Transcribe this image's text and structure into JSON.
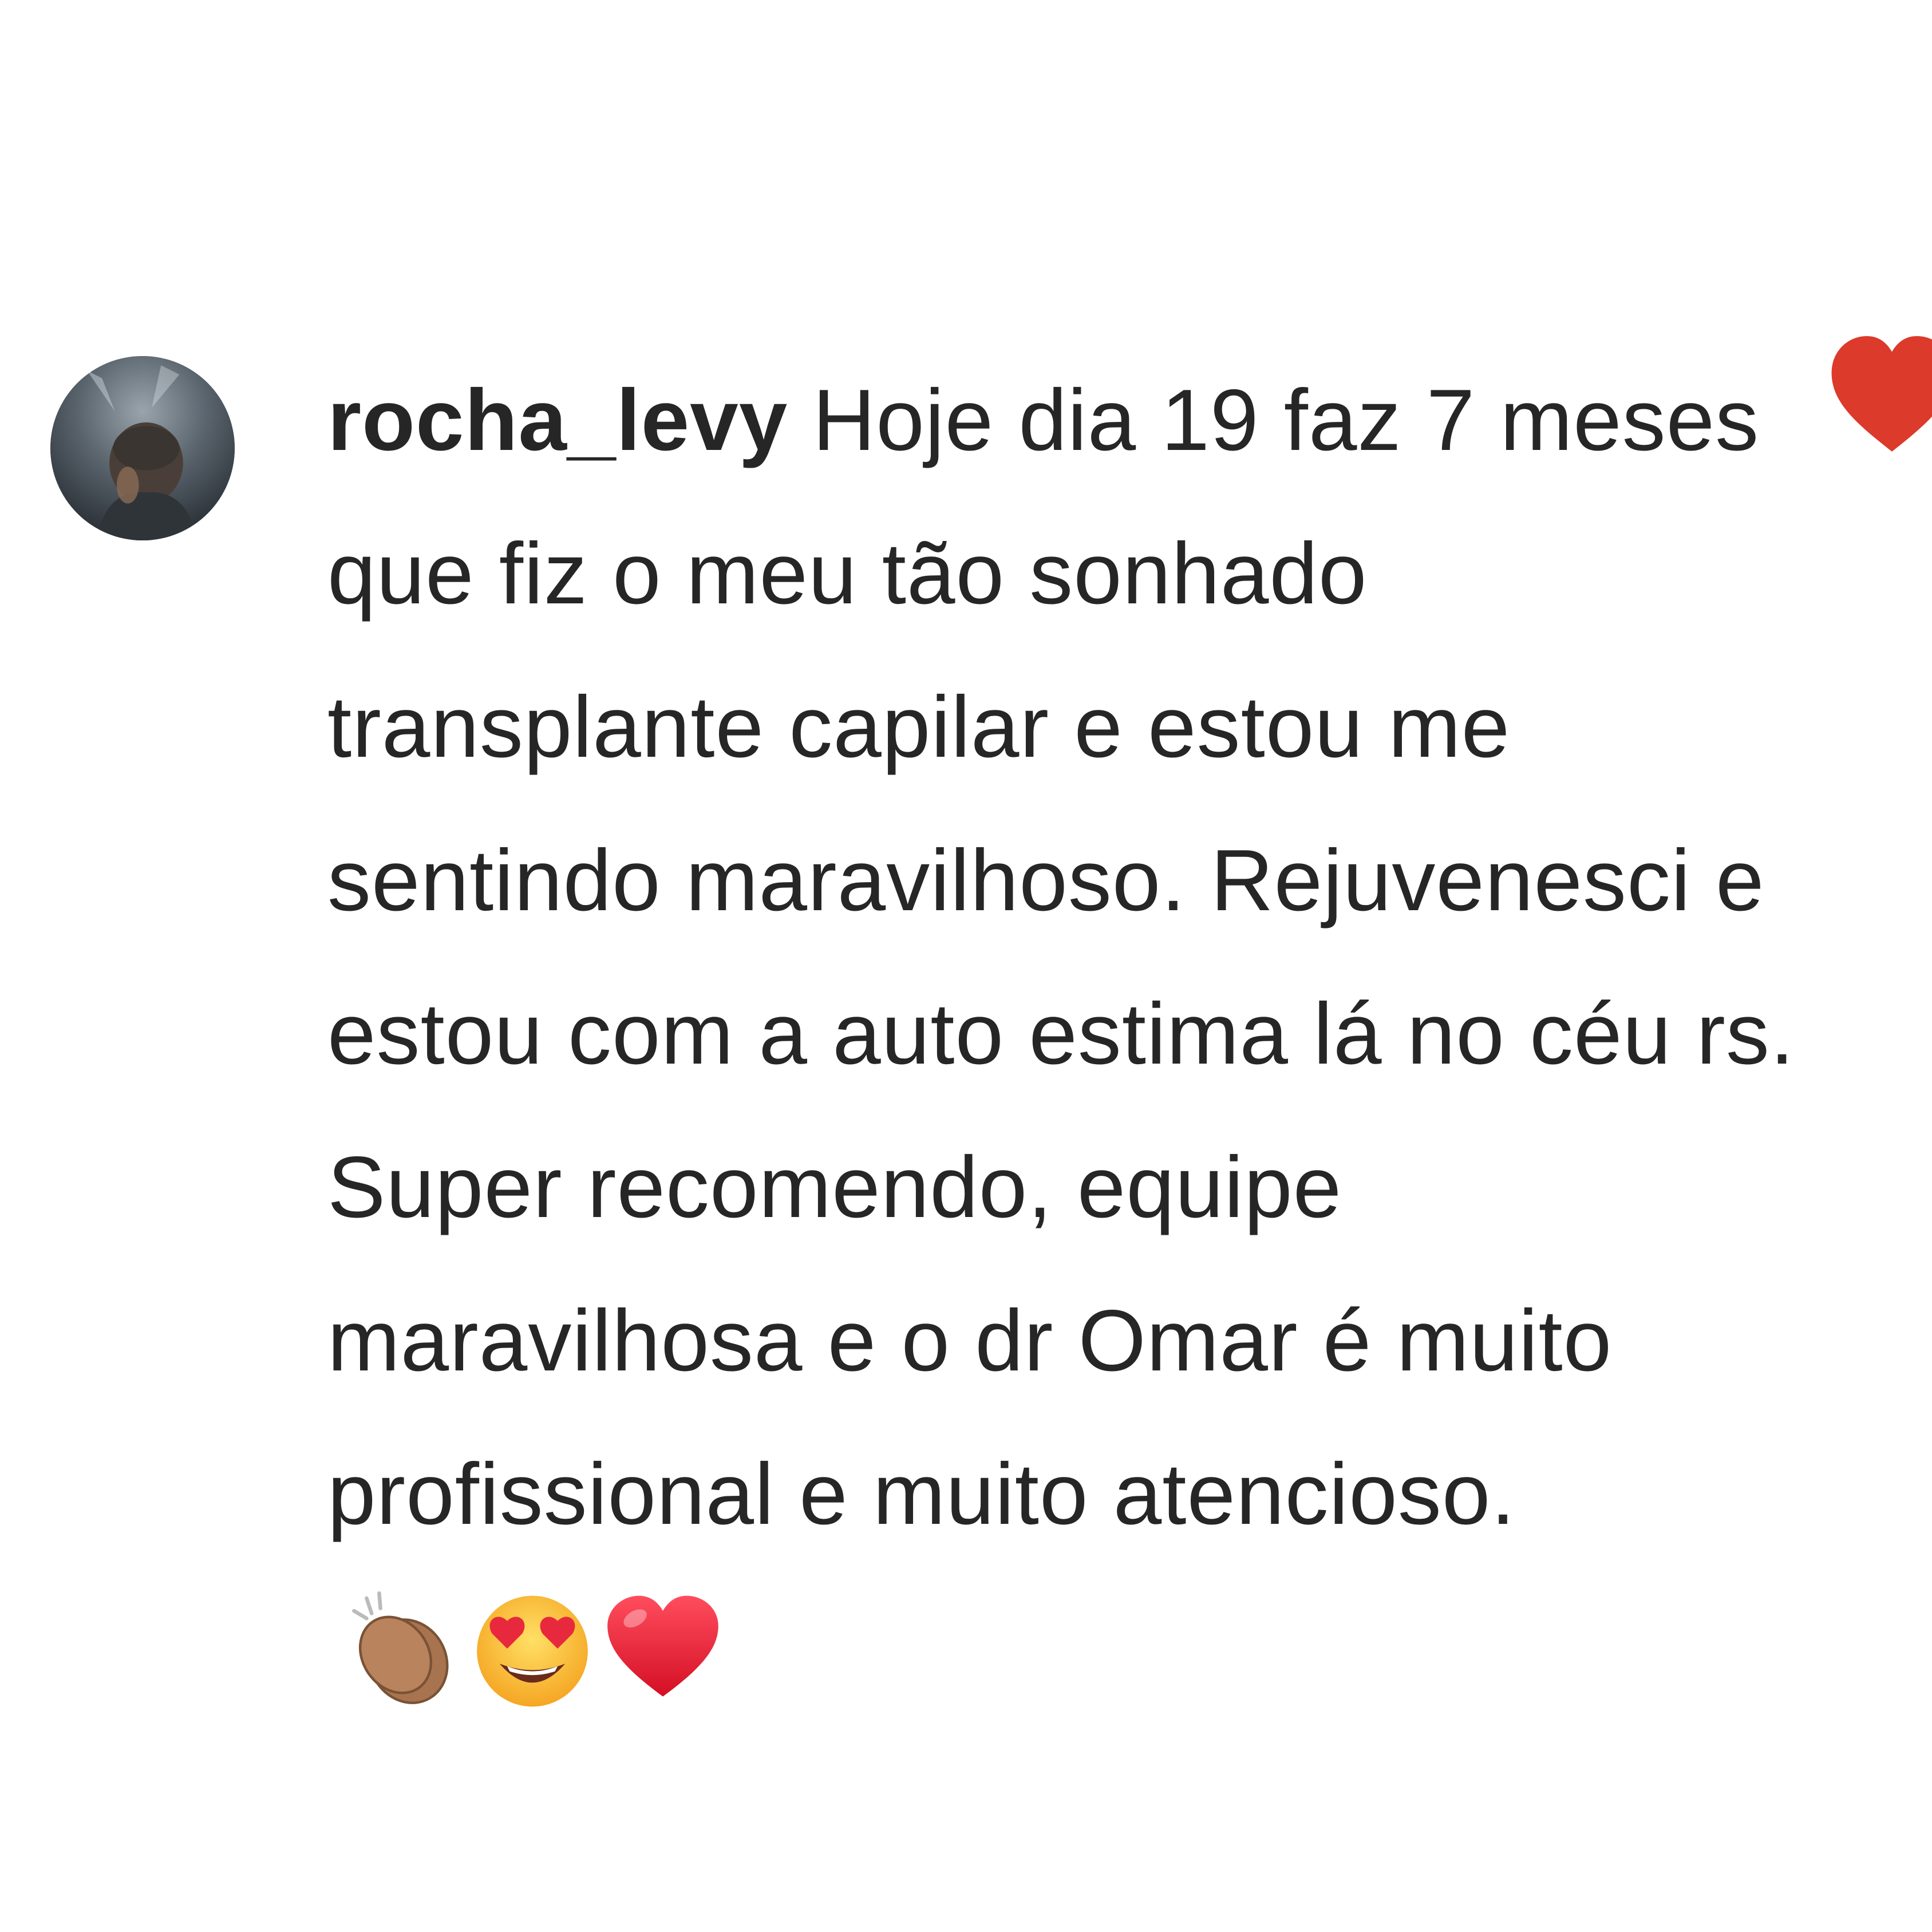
{
  "comment": {
    "username": "rocha_levy",
    "text": "Hoje dia 19 faz 7 meses que fiz o meu tão sonhado transplante capilar e estou me sentindo maravilhoso. Rejuvenesci e estou com a auto estima lá no céu rs. Super recomendo, equipe maravilhosa e o dr Omar é muito profissional e muito atencioso.",
    "emojis": [
      "clapping-hands-icon",
      "heart-eyes-face-icon",
      "red-heart-icon"
    ]
  },
  "like": {
    "icon": "heart-icon",
    "liked": true,
    "color": "#ed4956"
  },
  "colors": {
    "text": "#262626",
    "background": "#ffffff",
    "heart": "#ed4956"
  }
}
